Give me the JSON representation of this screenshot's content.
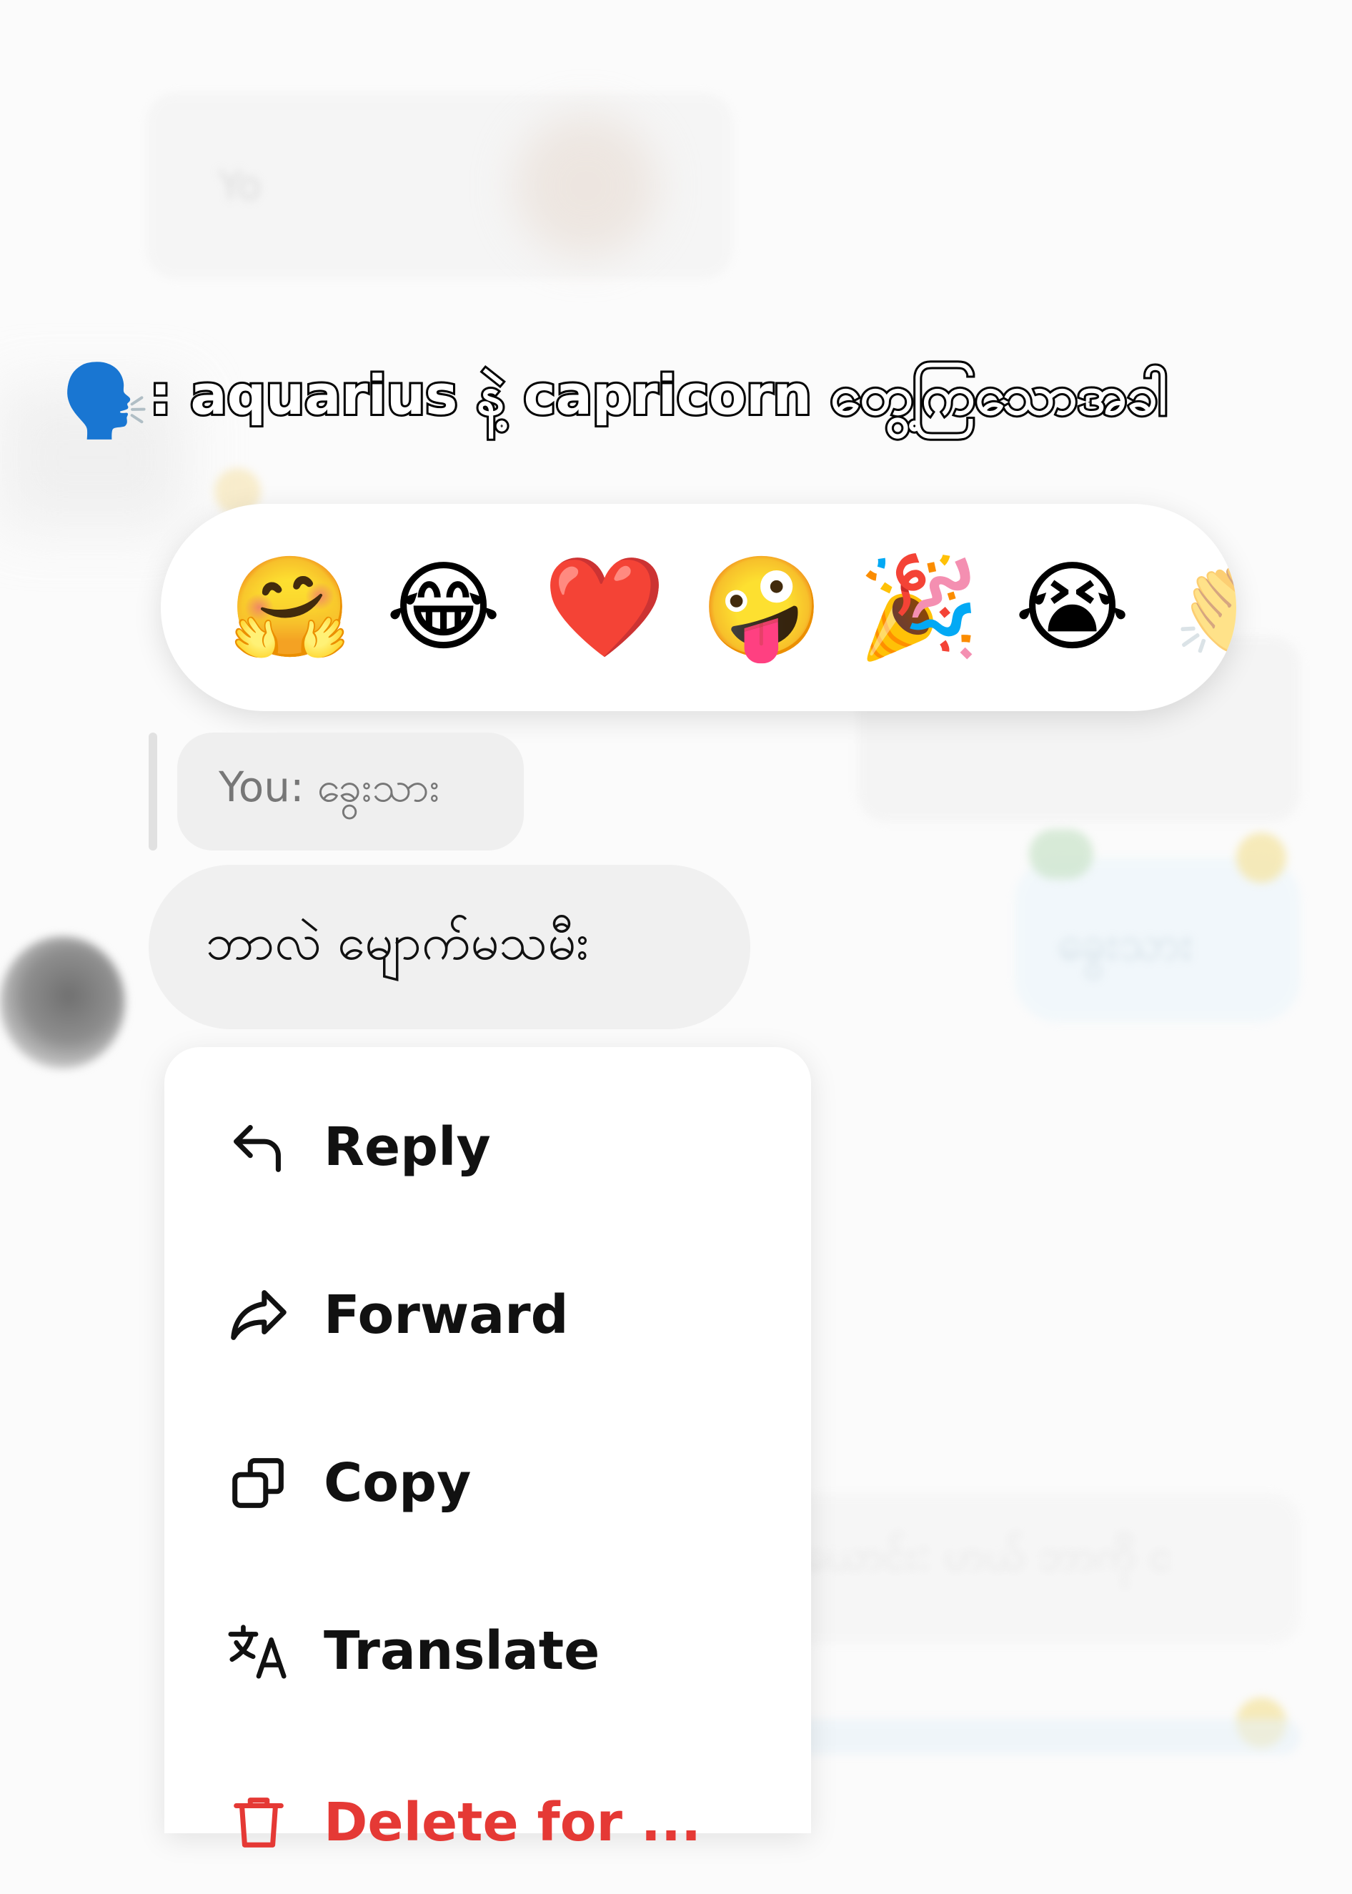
{
  "background": {
    "top_bubble_prefix": "Yo",
    "right_bubble_text": "ခွေးသား",
    "lower_bubble_text": "ယောင်း: ဟယ် ဘာကို င"
  },
  "caption": {
    "speaker_emoji": "🗣️",
    "text": ": aquarius နဲ့ capricorn တွေ့ကြသောအခါ"
  },
  "reactions": [
    "🤗",
    "😂",
    "❤️",
    "🤪",
    "🎉",
    "😭",
    "👏"
  ],
  "quoted_reply": {
    "text": "You: ခွေးသား"
  },
  "message": {
    "text": "ဘာလဲ မျောက်မသမီး"
  },
  "context_menu": {
    "items": [
      {
        "label": "Reply",
        "icon": "reply-icon"
      },
      {
        "label": "Forward",
        "icon": "forward-icon"
      },
      {
        "label": "Copy",
        "icon": "copy-icon"
      },
      {
        "label": "Translate",
        "icon": "translate-icon"
      },
      {
        "label": "Delete for ...",
        "icon": "trash-icon",
        "color": "#e53935"
      }
    ]
  },
  "colors": {
    "accent_danger": "#e53935",
    "bubble": "#f0f0f0"
  }
}
